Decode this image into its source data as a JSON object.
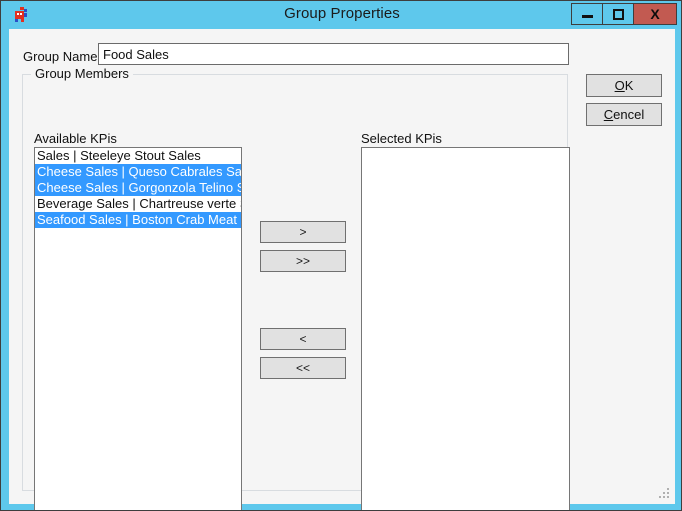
{
  "window": {
    "title": "Group Properties",
    "icon": "app-puzzle-icon",
    "titlebar_color": "#5ec8ec",
    "close_button_color": "#c25a51",
    "controls": {
      "minimize": "minimize-icon",
      "maximize": "maximize-icon",
      "close": "X"
    }
  },
  "form": {
    "group_name": {
      "label": "Group Name:",
      "value": "Food Sales",
      "placeholder": ""
    }
  },
  "group_members": {
    "legend": "Group Members",
    "available": {
      "label": "Available KPis",
      "items": [
        {
          "text": "Sales | Steeleye Stout Sales",
          "selected": false
        },
        {
          "text": "Cheese Sales | Queso Cabrales Sales",
          "selected": true
        },
        {
          "text": "Cheese Sales | Gorgonzola Telino Sales",
          "selected": true
        },
        {
          "text": "Beverage Sales | Chartreuse verte Sales",
          "selected": false
        },
        {
          "text": "Seafood Sales | Boston Crab Meat Sales",
          "selected": true
        }
      ]
    },
    "selected": {
      "label": "Selected KPis",
      "items": []
    },
    "transfer_buttons": [
      {
        "label": ">",
        "name": "move-right"
      },
      {
        "label": ">>",
        "name": "move-all-right"
      },
      {
        "label": "<",
        "name": "move-left"
      },
      {
        "label": "<<",
        "name": "move-all-left"
      }
    ]
  },
  "actions": {
    "ok": {
      "accel": "O",
      "rest": "K"
    },
    "cancel": {
      "accel": "C",
      "rest": "encel"
    }
  },
  "colors": {
    "selection_blue": "#3399ff",
    "dialog_face": "#f5f5f5",
    "button_face": "#e1e1e1"
  }
}
